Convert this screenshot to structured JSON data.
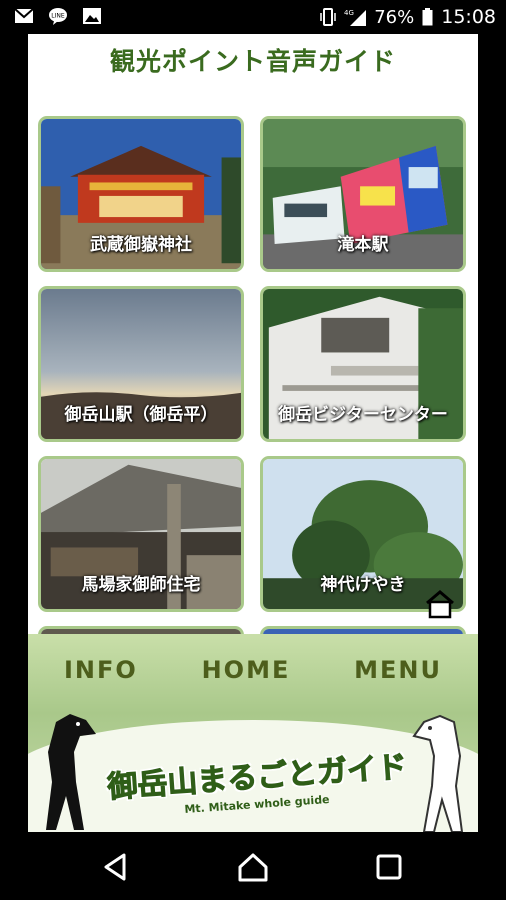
{
  "status_bar": {
    "notif_icons": [
      "gmail-icon",
      "line-icon",
      "gallery-icon"
    ],
    "signal": "4G",
    "battery": "76%",
    "time": "15:08"
  },
  "app": {
    "title": "観光ポイント音声ガイド",
    "cards": [
      {
        "label": "武蔵御嶽神社"
      },
      {
        "label": "滝本駅"
      },
      {
        "label": "御岳山駅（御岳平）"
      },
      {
        "label": "御岳ビジターセンター"
      },
      {
        "label": "馬場家御師住宅"
      },
      {
        "label": "神代けやき"
      }
    ],
    "nav": {
      "info": "INFO",
      "home": "HOME",
      "menu": "MENU"
    },
    "logo": {
      "main": "御岳山まるごとガイド",
      "sub": "Mt. Mitake whole guide"
    }
  },
  "colors": {
    "accent": "#3a6b1f",
    "card_border": "#a9c98a",
    "footer": "#b6d198"
  }
}
